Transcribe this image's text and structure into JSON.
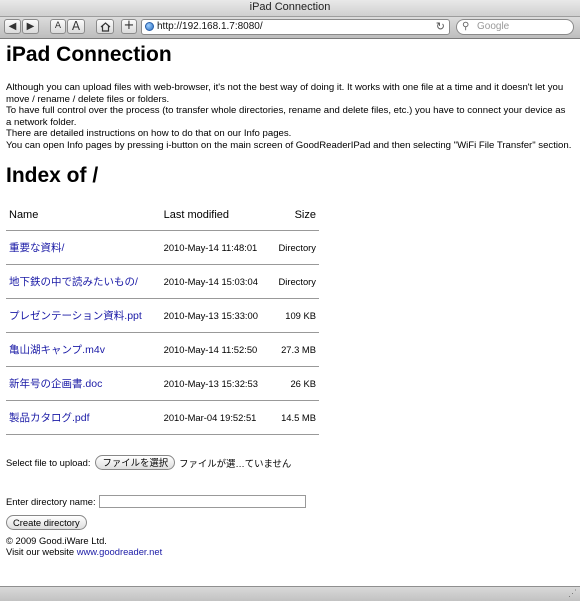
{
  "window": {
    "title": "iPad Connection"
  },
  "toolbar": {
    "back_icon": "back-arrow-icon",
    "forward_icon": "forward-arrow-icon",
    "text_smaller": "A",
    "text_larger": "A",
    "home_icon": "home-icon",
    "add_bookmark": "+",
    "url": "http://192.168.1.7:8080/",
    "reload_icon": "reload-icon",
    "search_placeholder": "Google"
  },
  "page": {
    "title": "iPad Connection",
    "intro": [
      "Although you can upload files with web-browser, it's not the best way of doing it. It works with one file at a time and it doesn't let you move / rename / delete files or folders.",
      "To have full control over the process (to transfer whole directories, rename and delete files, etc.) you have to connect your device as a network folder.",
      "There are detailed instructions on how to do that on our Info pages.",
      "You can open Info pages by pressing i-button on the main screen of GoodReaderIPad and then selecting \"WiFi File Transfer\" section."
    ],
    "index_heading": "Index of /",
    "table": {
      "headers": {
        "name": "Name",
        "modified": "Last modified",
        "size": "Size"
      },
      "rows": [
        {
          "name": "重要な資料/",
          "modified": "2010-May-14 11:48:01",
          "size": "Directory"
        },
        {
          "name": "地下鉄の中で読みたいもの/",
          "modified": "2010-May-14 15:03:04",
          "size": "Directory"
        },
        {
          "name": "プレゼンテーション資料.ppt",
          "modified": "2010-May-13 15:33:00",
          "size": "109 KB"
        },
        {
          "name": "亀山湖キャンプ.m4v",
          "modified": "2010-May-14 11:52:50",
          "size": "27.3 MB"
        },
        {
          "name": "新年号の企画書.doc",
          "modified": "2010-May-13 15:32:53",
          "size": "26 KB"
        },
        {
          "name": "製品カタログ.pdf",
          "modified": "2010-Mar-04 19:52:51",
          "size": "14.5 MB"
        }
      ]
    },
    "upload": {
      "label": "Select file to upload:",
      "choose_button": "ファイルを選択",
      "status": "ファイルが選…ていません"
    },
    "directory": {
      "label": "Enter directory name:",
      "value": "",
      "create_button": "Create directory"
    },
    "footer": {
      "copyright": "© 2009 Good.iWare Ltd.",
      "visit_prefix": "Visit our website ",
      "link_text": "www.goodreader.net"
    }
  }
}
